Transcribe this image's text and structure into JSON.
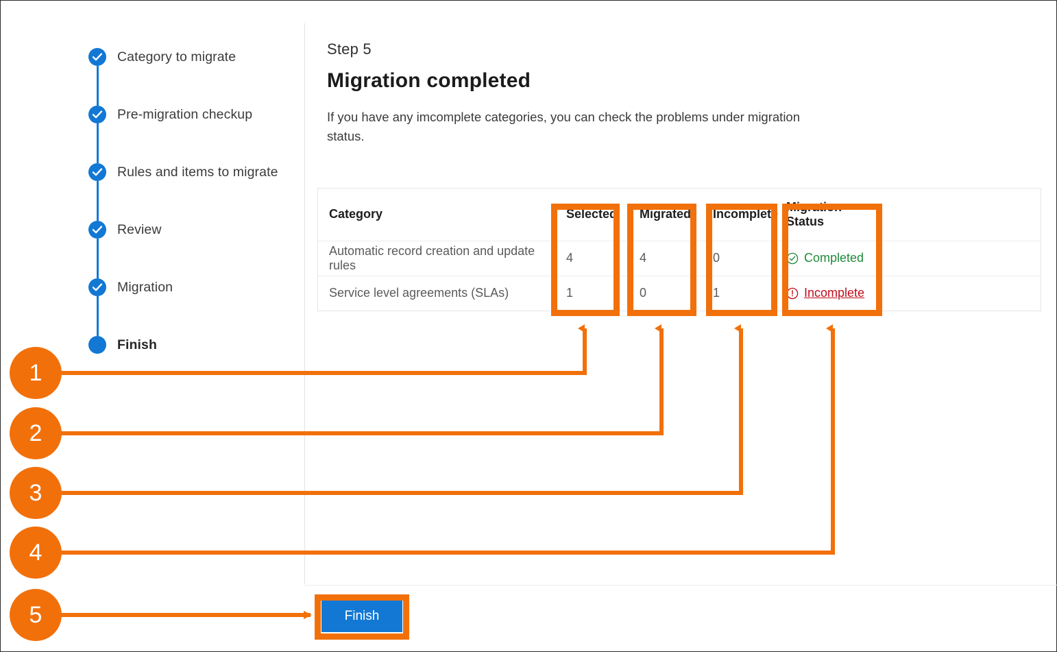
{
  "wizard": {
    "steps": [
      {
        "label": "Category to migrate",
        "state": "completed",
        "icon": "check-circle-icon"
      },
      {
        "label": "Pre-migration checkup",
        "state": "completed",
        "icon": "check-circle-icon"
      },
      {
        "label": "Rules and items to migrate",
        "state": "completed",
        "icon": "check-circle-icon"
      },
      {
        "label": "Review",
        "state": "completed",
        "icon": "check-circle-icon"
      },
      {
        "label": "Migration",
        "state": "completed",
        "icon": "check-circle-icon"
      },
      {
        "label": "Finish",
        "state": "current",
        "icon": "filled-dot-icon"
      }
    ]
  },
  "main": {
    "eyebrow": "Step 5",
    "title": "Migration completed",
    "description": "If you have any imcomplete categories, you can check the problems under migration status."
  },
  "table": {
    "columns": [
      "Category",
      "Selected",
      "Migrated",
      "Incomplete",
      "Migration Status"
    ],
    "rows": [
      {
        "category": "Automatic record creation and update rules",
        "selected": "4",
        "migrated": "4",
        "incomplete": "0",
        "status": "Completed",
        "status_icon": "check-circle-outline-icon"
      },
      {
        "category": "Service level agreements (SLAs)",
        "selected": "1",
        "migrated": "0",
        "incomplete": "1",
        "status": "Incomplete",
        "status_icon": "exclamation-circle-outline-icon"
      }
    ]
  },
  "footer": {
    "finish_label": "Finish"
  },
  "annotations": {
    "accent_color": "#f2700a",
    "callouts": [
      {
        "number": "1",
        "target": "selected-column"
      },
      {
        "number": "2",
        "target": "migrated-column"
      },
      {
        "number": "3",
        "target": "incomplete-column"
      },
      {
        "number": "4",
        "target": "migration-status-column"
      },
      {
        "number": "5",
        "target": "finish-button"
      }
    ]
  },
  "colors": {
    "step_blue": "#1278d4",
    "button_blue": "#1278d4",
    "status_completed_green": "#1f8a3b",
    "status_incomplete_red": "#c00c19"
  }
}
